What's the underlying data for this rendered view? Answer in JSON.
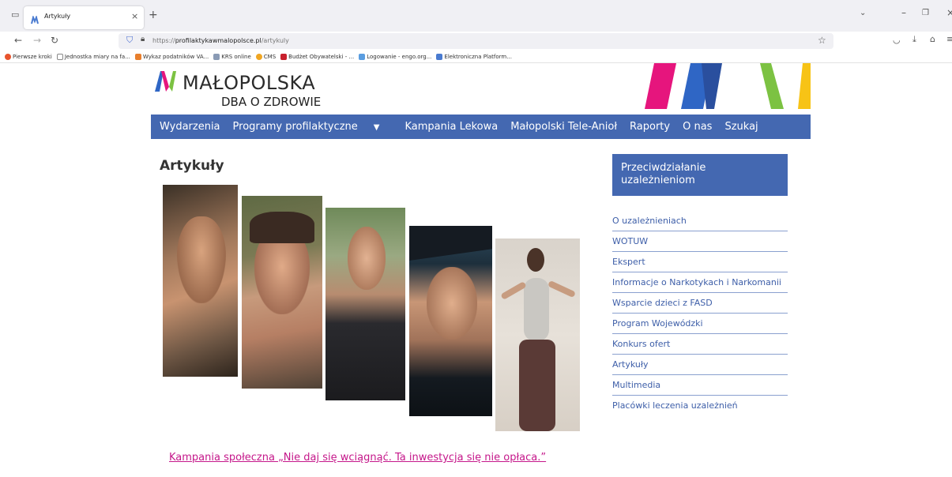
{
  "browser": {
    "tab_title": "Artykuły",
    "url_prefix": "https://",
    "url_host": "profilaktykawmalopolsce.pl",
    "url_path": "/artykuly",
    "bookmarks": [
      "Pierwsze kroki",
      "Jednostka miary na fa...",
      "Wykaz podatników VA...",
      "KRS online",
      "CMS",
      "Budżet Obywatelski - ...",
      "Logowanie - engo.org...",
      "Elektroniczna Platform..."
    ]
  },
  "site": {
    "logo_main": "MAŁOPOLSKA",
    "logo_sub": "DBA O ZDROWIE",
    "nav": [
      "Wydarzenia",
      "Programy profilaktyczne",
      "Kampania Lekowa",
      "Małopolski Tele-Anioł",
      "Raporty",
      "O nas",
      "Szukaj"
    ]
  },
  "main": {
    "title": "Artykuły",
    "campaign_link": "Kampania społeczna „Nie daj się wciągnąć. Ta inwestycja się nie opłaca.”"
  },
  "sidebar": {
    "heading": "Przeciwdziałanie uzależnieniom",
    "items": [
      "O uzależnieniach",
      "WOTUW",
      "Ekspert",
      "Informacje o Narkotykach i Narkomanii",
      "Wsparcie dzieci z FASD",
      "Program Wojewódzki",
      "Konkurs ofert",
      "Artykuły",
      "Multimedia",
      "Placówki leczenia uzależnień"
    ]
  },
  "colors": {
    "brand_blue": "#4468b1",
    "link_pink": "#c5178a"
  }
}
